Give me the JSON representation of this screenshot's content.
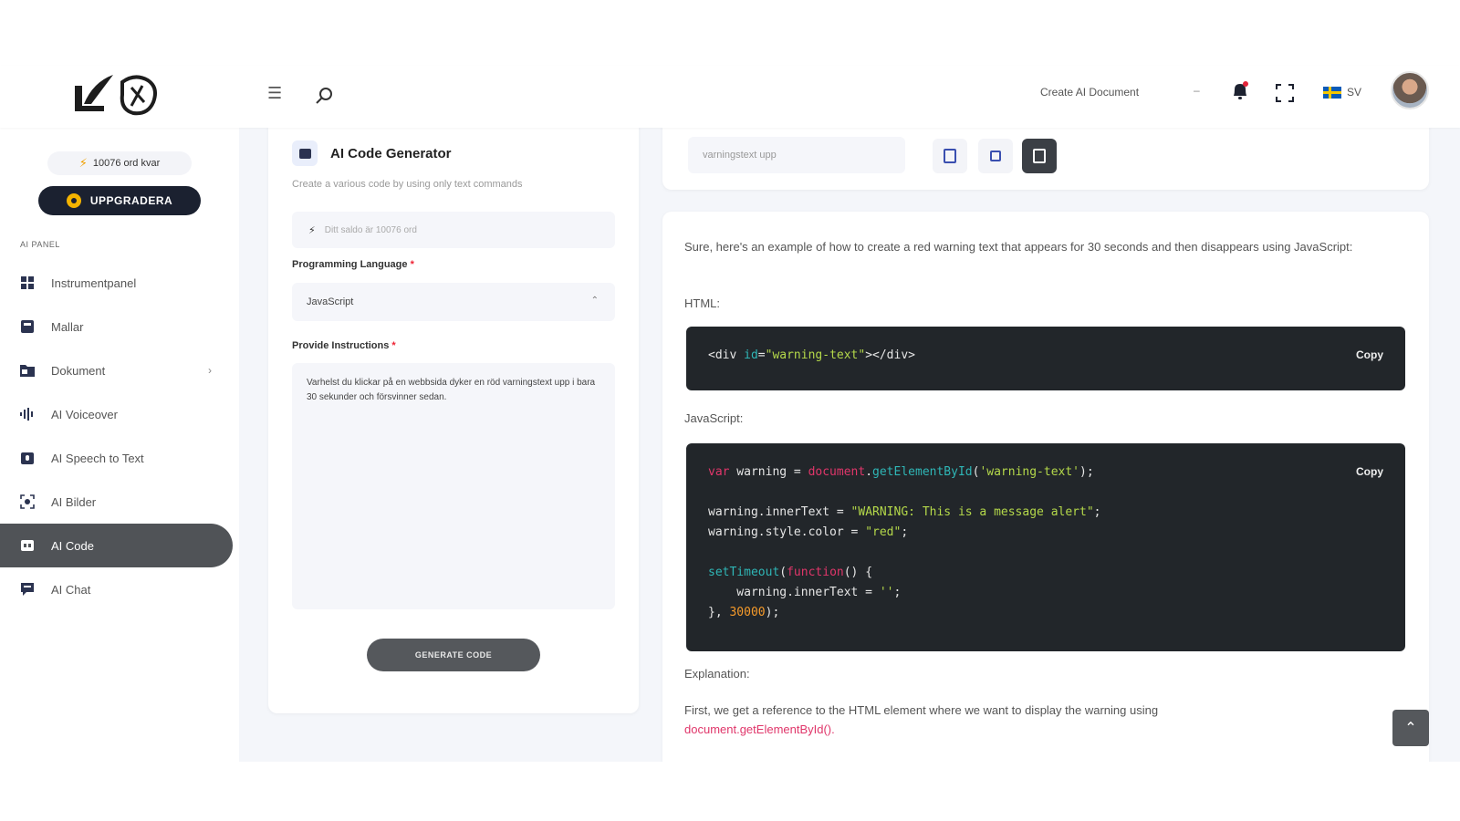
{
  "sidebar": {
    "words_pill": "10076 ord kvar",
    "upgrade_label": "UPPGRADERA",
    "section_label": "AI PANEL",
    "items": [
      {
        "label": "Instrumentpanel",
        "icon": "dashboard-icon"
      },
      {
        "label": "Mallar",
        "icon": "templates-icon"
      },
      {
        "label": "Dokument",
        "icon": "documents-icon"
      },
      {
        "label": "AI Voiceover",
        "icon": "voiceover-icon"
      },
      {
        "label": "AI Speech to Text",
        "icon": "speech-icon"
      },
      {
        "label": "AI Bilder",
        "icon": "image-icon"
      },
      {
        "label": "AI Code",
        "icon": "code-icon"
      },
      {
        "label": "AI Chat",
        "icon": "chat-icon"
      }
    ]
  },
  "header": {
    "create_doc": "Create AI Document",
    "create_dash": "–",
    "lang": "SV"
  },
  "generator": {
    "title": "AI Code Generator",
    "subtitle": "Create a various code by using only text commands",
    "words_hint": "Ditt saldo är 10076 ord",
    "lang_label": "Programming Language",
    "lang_value": "JavaScript",
    "instr_label": "Provide Instructions",
    "instr_value": "Varhelst du klickar på en webbsida dyker en röd varningstext upp i bara 30 sekunder och försvinner sedan.",
    "button": "GENERATE CODE"
  },
  "document": {
    "name": "varningstext upp"
  },
  "result": {
    "intro": "Sure, here's an example of how to create a red warning text that appears for 30 seconds and then disappears using JavaScript:",
    "html_label": "HTML:",
    "copy": "Copy",
    "js_label": "JavaScript:",
    "expl_label": "Explanation:",
    "expl_text": "First, we get a reference to the HTML element where we want to display the warning using",
    "expl_link": "document.getElementById()."
  },
  "colors": {
    "accent_dark": "#1b2130",
    "active_nav": "#505357",
    "code_bg": "#22262a"
  }
}
